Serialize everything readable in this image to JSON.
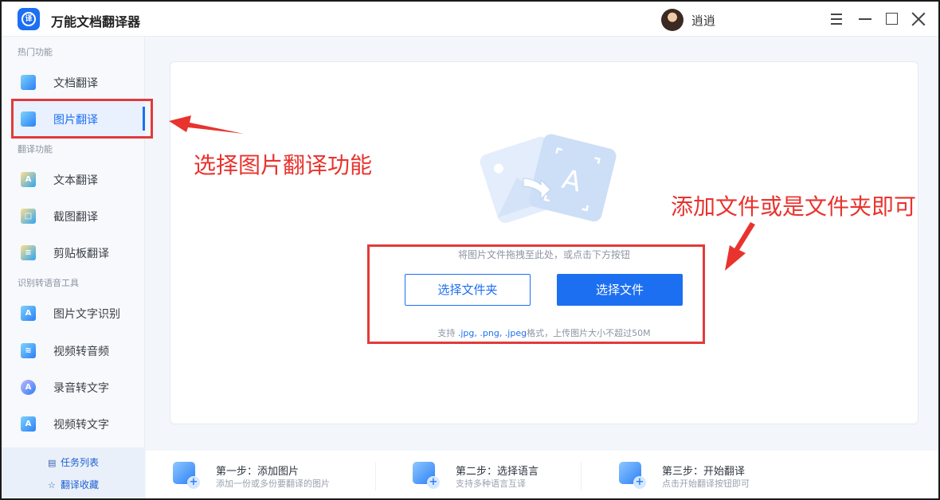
{
  "app": {
    "title": "万能文档翻译器",
    "username": "逍逍",
    "logo_glyph": "译"
  },
  "sidebar": {
    "sections": [
      {
        "title": "热门功能",
        "items": [
          {
            "label": "文档翻译",
            "icon": "document-icon"
          },
          {
            "label": "图片翻译",
            "icon": "image-icon",
            "active": true
          }
        ]
      },
      {
        "title": "翻译功能",
        "items": [
          {
            "label": "文本翻译",
            "icon": "text-icon"
          },
          {
            "label": "截图翻译",
            "icon": "screenshot-icon"
          },
          {
            "label": "剪贴板翻译",
            "icon": "clipboard-icon"
          }
        ]
      },
      {
        "title": "识别转语音工具",
        "items": [
          {
            "label": "图片文字识别",
            "icon": "ocr-icon"
          },
          {
            "label": "视频转音频",
            "icon": "video-audio-icon"
          },
          {
            "label": "录音转文字",
            "icon": "recording-icon"
          },
          {
            "label": "视频转文字",
            "icon": "video-text-icon"
          }
        ]
      }
    ],
    "footer": [
      {
        "label": "任务列表",
        "icon": "list-icon",
        "glyph": "▤"
      },
      {
        "label": "翻译收藏",
        "icon": "star-icon",
        "glyph": "☆"
      }
    ]
  },
  "upload": {
    "hint": "将图片文件拖拽至此处，或点击下方按钮",
    "select_folder": "选择文件夹",
    "select_file": "选择文件",
    "support_prefix": "支持",
    "support_formats": ".jpg, .png, .jpeg",
    "support_suffix": "格式，上传图片大小不超过50M"
  },
  "steps": [
    {
      "title": "第一步：添加图片",
      "desc": "添加一份或多份要翻译的图片"
    },
    {
      "title": "第二步：选择语言",
      "desc": "支持多种语言互译"
    },
    {
      "title": "第三步：开始翻译",
      "desc": "点击开始翻译按钮即可"
    }
  ],
  "annotations": {
    "left_text": "选择图片翻译功能",
    "right_text": "添加文件或是文件夹即可",
    "color": "#e8332e"
  },
  "colors": {
    "accent": "#1d6ff2"
  }
}
